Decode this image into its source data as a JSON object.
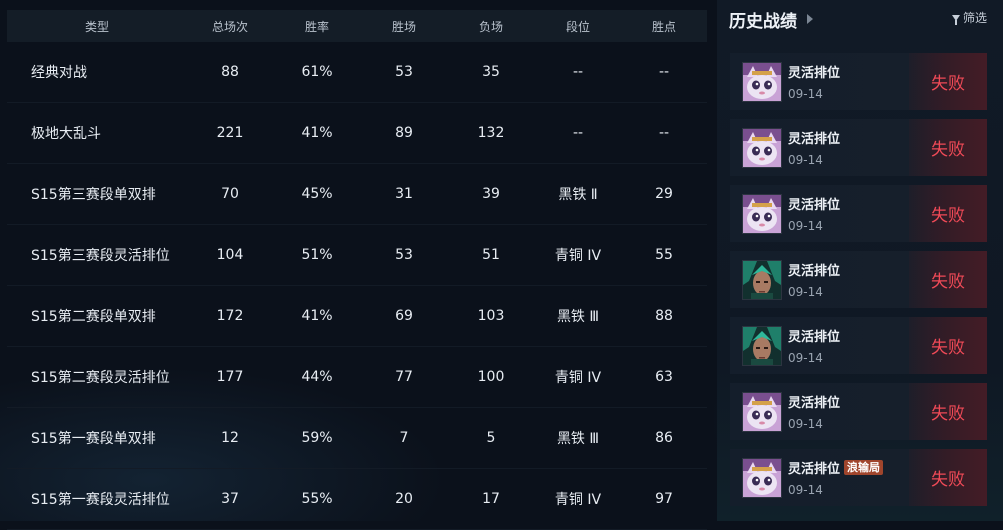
{
  "stats_table": {
    "headers": [
      "类型",
      "总场次",
      "胜率",
      "胜场",
      "负场",
      "段位",
      "胜点"
    ],
    "rows": [
      [
        "经典对战",
        "88",
        "61%",
        "53",
        "35",
        "--",
        "--"
      ],
      [
        "极地大乱斗",
        "221",
        "41%",
        "89",
        "132",
        "--",
        "--"
      ],
      [
        "S15第三赛段单双排",
        "70",
        "45%",
        "31",
        "39",
        "黑铁 Ⅱ",
        "29"
      ],
      [
        "S15第三赛段灵活排位",
        "104",
        "51%",
        "53",
        "51",
        "青铜 IV",
        "55"
      ],
      [
        "S15第二赛段单双排",
        "172",
        "41%",
        "69",
        "103",
        "黑铁 Ⅲ",
        "88"
      ],
      [
        "S15第二赛段灵活排位",
        "177",
        "44%",
        "77",
        "100",
        "青铜 IV",
        "63"
      ],
      [
        "S15第一赛段单双排",
        "12",
        "59%",
        "7",
        "5",
        "黑铁 Ⅲ",
        "86"
      ],
      [
        "S15第一赛段灵活排位",
        "37",
        "55%",
        "20",
        "17",
        "青铜 IV",
        "97"
      ]
    ]
  },
  "history": {
    "title": "历史战绩",
    "filter_label": "筛选",
    "matches": [
      {
        "mode": "灵活排位",
        "date": "09-14",
        "result": "失败",
        "champion_icon": "cat-champion-icon",
        "tag": ""
      },
      {
        "mode": "灵活排位",
        "date": "09-14",
        "result": "失败",
        "champion_icon": "cat-champion-icon",
        "tag": ""
      },
      {
        "mode": "灵活排位",
        "date": "09-14",
        "result": "失败",
        "champion_icon": "cat-champion-icon",
        "tag": ""
      },
      {
        "mode": "灵活排位",
        "date": "09-14",
        "result": "失败",
        "champion_icon": "green-warrior-champion-icon",
        "tag": ""
      },
      {
        "mode": "灵活排位",
        "date": "09-14",
        "result": "失败",
        "champion_icon": "green-warrior-champion-icon",
        "tag": ""
      },
      {
        "mode": "灵活排位",
        "date": "09-14",
        "result": "失败",
        "champion_icon": "cat-champion-icon",
        "tag": ""
      },
      {
        "mode": "灵活排位",
        "date": "09-14",
        "result": "失败",
        "champion_icon": "cat-champion-icon",
        "tag": "浪输局"
      }
    ]
  },
  "colors": {
    "loss": "#f04a57",
    "tag_bg": "#a0452c"
  }
}
